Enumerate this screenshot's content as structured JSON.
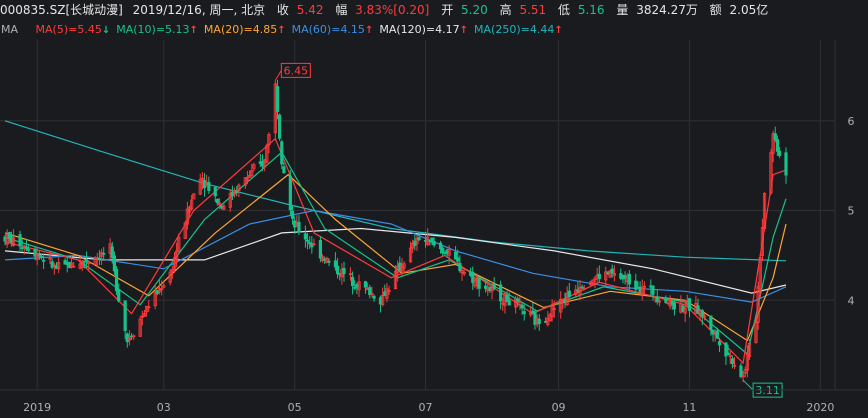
{
  "header": {
    "code": "000835.SZ[长城动漫]",
    "date": "2019/12/16, 周一, 北京",
    "close_label": "收",
    "close": "5.42",
    "change_label": "幅",
    "change_pct": "3.83%",
    "change_abs": "[0.20]",
    "open_label": "开",
    "open": "5.20",
    "high_label": "高",
    "high": "5.51",
    "low_label": "低",
    "low": "5.16",
    "volume_label": "量",
    "volume": "3824.27万",
    "amount_label": "额",
    "amount": "2.05亿"
  },
  "ma_bar": {
    "label": "MA",
    "items": [
      {
        "text": "MA(5)=5.45",
        "color": "#ff3b3b",
        "arrow": "down",
        "arrow_color": "#17c28a"
      },
      {
        "text": "MA(10)=5.13",
        "color": "#17c28a",
        "arrow": "up",
        "arrow_color": "#ff3b3b"
      },
      {
        "text": "MA(20)=4.85",
        "color": "#ffa534",
        "arrow": "up",
        "arrow_color": "#ff3b3b"
      },
      {
        "text": "MA(60)=4.15",
        "color": "#3a8ee6",
        "arrow": "up",
        "arrow_color": "#ff3b3b"
      },
      {
        "text": "MA(120)=4.17",
        "color": "#e8e8e8",
        "arrow": "up",
        "arrow_color": "#ff3b3b"
      },
      {
        "text": "MA(250)=4.44",
        "color": "#22b3b8",
        "arrow": "up",
        "arrow_color": "#ff3b3b"
      }
    ]
  },
  "chart_data": {
    "type": "candlestick",
    "colors": {
      "up": "#ff3b3b",
      "down": "#17c28a",
      "ma5": "#ff3b3b",
      "ma10": "#17c28a",
      "ma20": "#ffa534",
      "ma60": "#3a8ee6",
      "ma120": "#e8e8e8",
      "ma250": "#22b3b8",
      "grid": "#2e3036",
      "axis_text": "#b0b0b0",
      "background": "#1a1b1f"
    },
    "grid": true,
    "x_tick_labels": [
      "2019",
      "03",
      "05",
      "07",
      "09",
      "11",
      "2020"
    ],
    "y_tick_labels": [
      "4",
      "5",
      "6"
    ],
    "ylim": [
      3.0,
      6.9
    ],
    "period_start": "2018-12-17",
    "period_end": "2019-12-16",
    "high_marker": {
      "date": "2019-04-22",
      "value": "6.45"
    },
    "low_marker": {
      "date": "2019-11-26",
      "value": "3.11"
    },
    "close_path": [
      [
        "2018-12-17",
        4.7
      ],
      [
        "2018-12-28",
        4.6
      ],
      [
        "2019-01-10",
        4.35
      ],
      [
        "2019-01-25",
        4.45
      ],
      [
        "2019-02-04",
        4.55
      ],
      [
        "2019-02-12",
        3.55
      ],
      [
        "2019-02-22",
        3.95
      ],
      [
        "2019-03-04",
        4.3
      ],
      [
        "2019-03-11",
        4.9
      ],
      [
        "2019-03-18",
        5.4
      ],
      [
        "2019-03-28",
        5.05
      ],
      [
        "2019-04-08",
        5.35
      ],
      [
        "2019-04-17",
        5.55
      ],
      [
        "2019-04-22",
        6.4
      ],
      [
        "2019-04-25",
        5.6
      ],
      [
        "2019-04-30",
        4.85
      ],
      [
        "2019-05-10",
        4.6
      ],
      [
        "2019-05-20",
        4.35
      ],
      [
        "2019-05-30",
        4.2
      ],
      [
        "2019-06-10",
        4.0
      ],
      [
        "2019-06-20",
        4.4
      ],
      [
        "2019-06-28",
        4.7
      ],
      [
        "2019-07-10",
        4.55
      ],
      [
        "2019-07-20",
        4.3
      ],
      [
        "2019-08-01",
        4.1
      ],
      [
        "2019-08-12",
        3.95
      ],
      [
        "2019-08-22",
        3.75
      ],
      [
        "2019-09-01",
        3.95
      ],
      [
        "2019-09-12",
        4.2
      ],
      [
        "2019-09-25",
        4.3
      ],
      [
        "2019-10-10",
        4.15
      ],
      [
        "2019-10-25",
        3.95
      ],
      [
        "2019-11-05",
        3.9
      ],
      [
        "2019-11-15",
        3.55
      ],
      [
        "2019-11-26",
        3.15
      ],
      [
        "2019-12-02",
        3.8
      ],
      [
        "2019-12-06",
        5.2
      ],
      [
        "2019-12-10",
        5.85
      ],
      [
        "2019-12-16",
        5.42
      ]
    ],
    "ma_lines": {
      "ma5": [
        [
          "2018-12-17",
          4.65
        ],
        [
          "2019-01-20",
          4.45
        ],
        [
          "2019-02-14",
          3.85
        ],
        [
          "2019-03-15",
          5.0
        ],
        [
          "2019-04-22",
          5.8
        ],
        [
          "2019-05-10",
          4.75
        ],
        [
          "2019-06-15",
          4.25
        ],
        [
          "2019-07-10",
          4.5
        ],
        [
          "2019-08-20",
          3.85
        ],
        [
          "2019-09-20",
          4.2
        ],
        [
          "2019-10-30",
          3.95
        ],
        [
          "2019-11-26",
          3.3
        ],
        [
          "2019-12-10",
          5.4
        ],
        [
          "2019-12-16",
          5.45
        ]
      ],
      "ma10": [
        [
          "2018-12-17",
          4.7
        ],
        [
          "2019-01-20",
          4.45
        ],
        [
          "2019-02-18",
          3.95
        ],
        [
          "2019-03-20",
          4.9
        ],
        [
          "2019-04-25",
          5.65
        ],
        [
          "2019-05-15",
          4.8
        ],
        [
          "2019-06-18",
          4.25
        ],
        [
          "2019-07-12",
          4.45
        ],
        [
          "2019-08-22",
          3.88
        ],
        [
          "2019-09-22",
          4.15
        ],
        [
          "2019-10-30",
          3.98
        ],
        [
          "2019-11-28",
          3.4
        ],
        [
          "2019-12-10",
          4.7
        ],
        [
          "2019-12-16",
          5.13
        ]
      ],
      "ma20": [
        [
          "2018-12-17",
          4.75
        ],
        [
          "2019-01-20",
          4.5
        ],
        [
          "2019-02-22",
          4.05
        ],
        [
          "2019-03-25",
          4.75
        ],
        [
          "2019-04-28",
          5.4
        ],
        [
          "2019-05-20",
          4.9
        ],
        [
          "2019-06-20",
          4.3
        ],
        [
          "2019-07-15",
          4.4
        ],
        [
          "2019-08-25",
          3.92
        ],
        [
          "2019-09-25",
          4.1
        ],
        [
          "2019-10-30",
          4.0
        ],
        [
          "2019-11-28",
          3.55
        ],
        [
          "2019-12-10",
          4.25
        ],
        [
          "2019-12-16",
          4.85
        ]
      ],
      "ma60": [
        [
          "2018-12-17",
          4.45
        ],
        [
          "2019-01-20",
          4.5
        ],
        [
          "2019-03-01",
          4.35
        ],
        [
          "2019-04-10",
          4.85
        ],
        [
          "2019-05-10",
          5.0
        ],
        [
          "2019-06-15",
          4.85
        ],
        [
          "2019-07-15",
          4.55
        ],
        [
          "2019-08-20",
          4.3
        ],
        [
          "2019-09-25",
          4.15
        ],
        [
          "2019-10-30",
          4.1
        ],
        [
          "2019-11-30",
          3.98
        ],
        [
          "2019-12-16",
          4.15
        ]
      ],
      "ma120": [
        [
          "2018-12-17",
          4.55
        ],
        [
          "2019-02-01",
          4.45
        ],
        [
          "2019-03-20",
          4.45
        ],
        [
          "2019-04-25",
          4.75
        ],
        [
          "2019-06-01",
          4.8
        ],
        [
          "2019-07-15",
          4.7
        ],
        [
          "2019-08-30",
          4.55
        ],
        [
          "2019-10-15",
          4.35
        ],
        [
          "2019-11-30",
          4.08
        ],
        [
          "2019-12-16",
          4.17
        ]
      ],
      "ma250": [
        [
          "2018-12-17",
          6.0
        ],
        [
          "2019-02-01",
          5.65
        ],
        [
          "2019-03-20",
          5.3
        ],
        [
          "2019-05-01",
          5.05
        ],
        [
          "2019-06-15",
          4.8
        ],
        [
          "2019-08-01",
          4.65
        ],
        [
          "2019-09-15",
          4.55
        ],
        [
          "2019-10-30",
          4.48
        ],
        [
          "2019-12-16",
          4.44
        ]
      ]
    }
  }
}
